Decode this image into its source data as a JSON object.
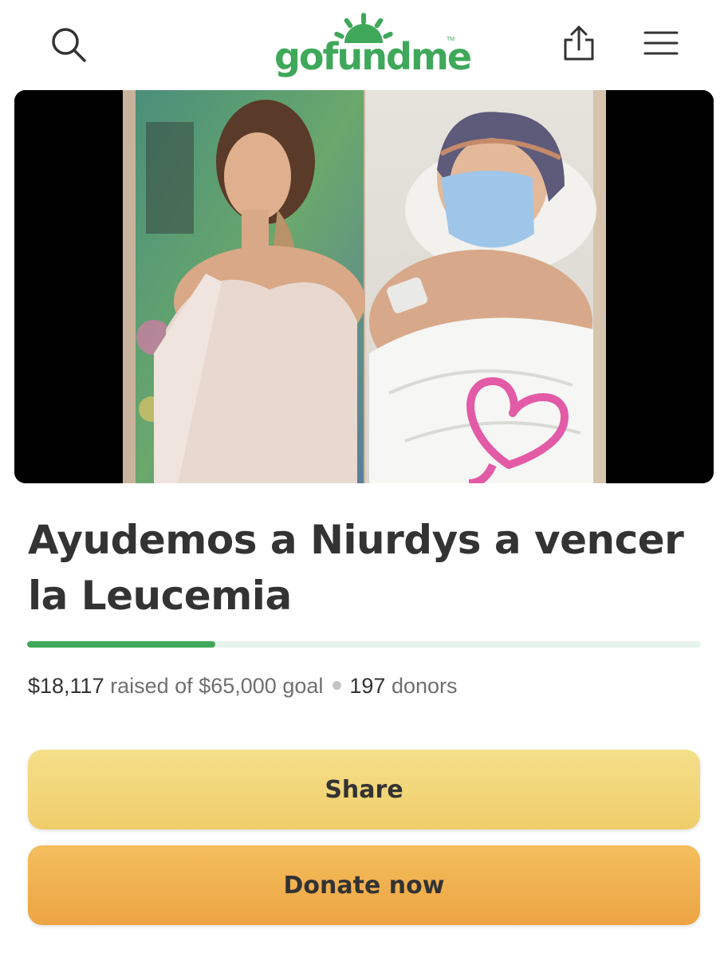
{
  "brand": {
    "logo_text": "gofundme",
    "logo_tm": "TM",
    "color": "#3fa85a"
  },
  "header": {
    "left_icon": "search-icon",
    "right_icons": [
      "share-upload-icon",
      "hamburger-menu-icon"
    ]
  },
  "hero_image": {
    "description_icon": "campaign-photo"
  },
  "campaign": {
    "title": "Ayudemos a Niurdys a vencer la Leucemia",
    "progress_fraction": 0.2787,
    "raised": "$18,117",
    "raised_label": "raised of",
    "goal": "$65,000",
    "goal_label": "goal",
    "donor_count": "197",
    "donors_label": "donors"
  },
  "actions": {
    "share_label": "Share",
    "donate_label": "Donate now",
    "share_color": "#f3d77b",
    "donate_color": "#f0b04f"
  }
}
